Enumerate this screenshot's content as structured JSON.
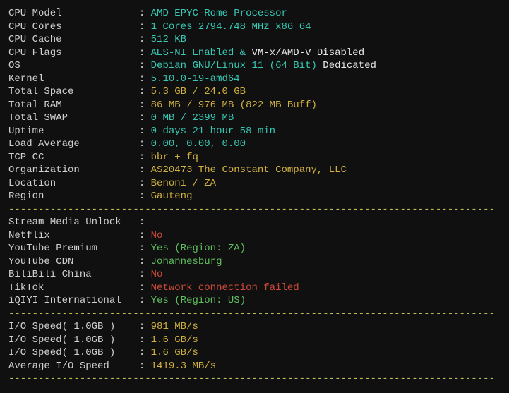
{
  "sys": {
    "cpu_model": {
      "label": "CPU Model",
      "value": "AMD EPYC-Rome Processor"
    },
    "cpu_cores": {
      "label": "CPU Cores",
      "value": "1 Cores 2794.748 MHz x86_64"
    },
    "cpu_cache": {
      "label": "CPU Cache",
      "value": "512 KB"
    },
    "cpu_flags": {
      "label": "CPU Flags",
      "part1": "AES-NI Enabled & ",
      "part2": "VM-x/AMD-V Disabled"
    },
    "os": {
      "label": "OS",
      "part1": "Debian GNU/Linux 11 (64 Bit) ",
      "part2": "Dedicated"
    },
    "kernel": {
      "label": "Kernel",
      "value": "5.10.0-19-amd64"
    },
    "total_space": {
      "label": "Total Space",
      "value": "5.3 GB / 24.0 GB"
    },
    "total_ram": {
      "label": "Total RAM",
      "value": "86 MB / 976 MB (822 MB Buff)"
    },
    "total_swap": {
      "label": "Total SWAP",
      "value": "0 MB / 2399 MB"
    },
    "uptime": {
      "label": "Uptime",
      "value": "0 days 21 hour 58 min"
    },
    "load_avg": {
      "label": "Load Average",
      "value": "0.00, 0.00, 0.00"
    },
    "tcp_cc": {
      "label": "TCP CC",
      "value": "bbr + fq"
    },
    "org": {
      "label": "Organization",
      "value": "AS20473 The Constant Company, LLC"
    },
    "location": {
      "label": "Location",
      "value": "Benoni / ZA"
    },
    "region": {
      "label": "Region",
      "value": "Gauteng"
    }
  },
  "stream": {
    "heading": "Stream Media Unlock",
    "netflix": {
      "label": "Netflix",
      "value": "No"
    },
    "yt_premium": {
      "label": "YouTube Premium",
      "value": "Yes (Region: ZA)"
    },
    "yt_cdn": {
      "label": "YouTube CDN",
      "value": "Johannesburg"
    },
    "bilibili": {
      "label": "BiliBili China",
      "value": "No"
    },
    "tiktok": {
      "label": "TikTok",
      "value": "Network connection failed"
    },
    "iqiyi": {
      "label": "iQIYI International",
      "value": "Yes (Region: US)"
    }
  },
  "io": {
    "s1": {
      "label": "I/O Speed( 1.0GB )",
      "value": "981 MB/s"
    },
    "s2": {
      "label": "I/O Speed( 1.0GB )",
      "value": "1.6 GB/s"
    },
    "s3": {
      "label": "I/O Speed( 1.0GB )",
      "value": "1.6 GB/s"
    },
    "avg": {
      "label": "Average I/O Speed",
      "value": "1419.3 MB/s"
    }
  },
  "divider": "----------------------------------------------------------------------------------"
}
